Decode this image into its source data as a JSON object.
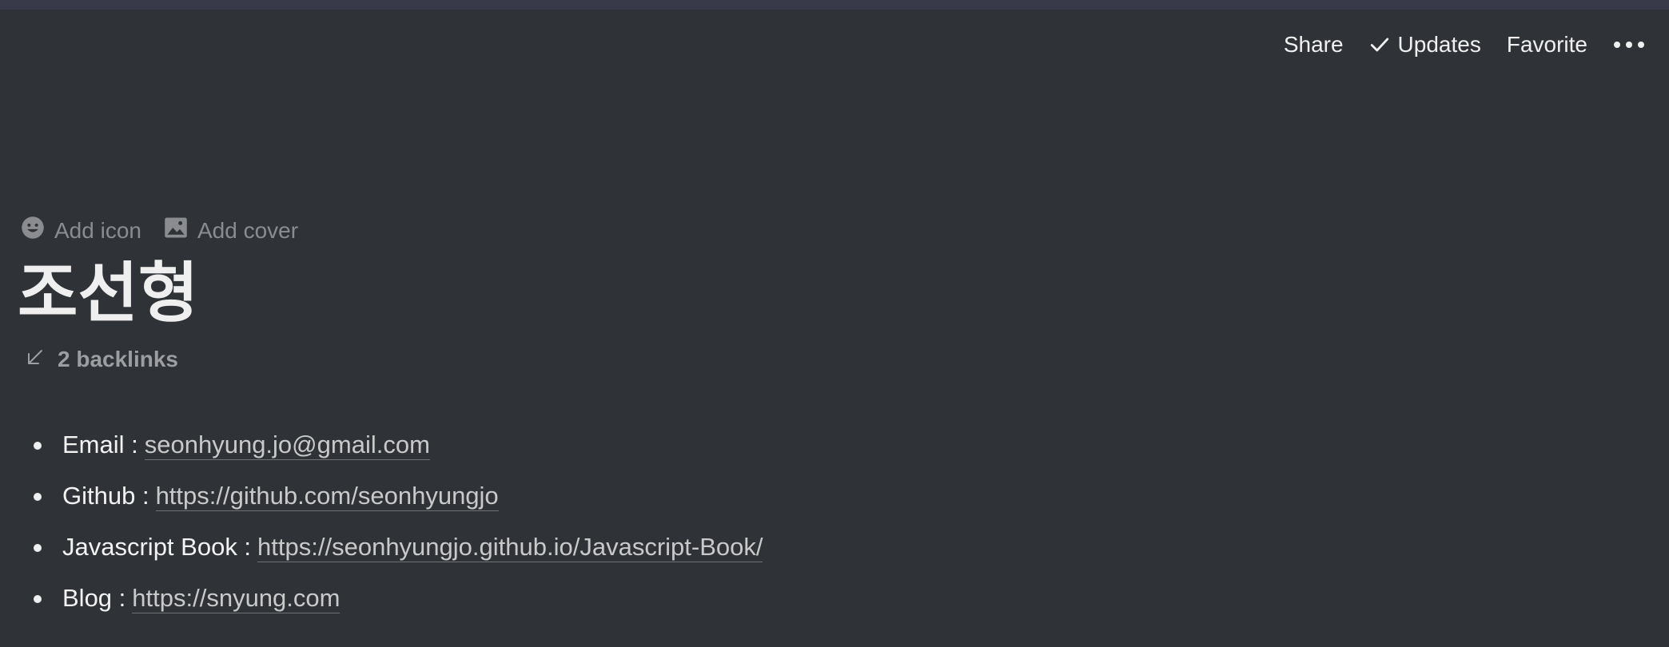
{
  "topbar": {
    "share_label": "Share",
    "updates_label": "Updates",
    "favorite_label": "Favorite",
    "more_icon": "more-horizontal-icon"
  },
  "page_actions": {
    "add_icon_label": "Add icon",
    "add_cover_label": "Add cover"
  },
  "page": {
    "title": "조선형",
    "backlinks_label": "2 backlinks"
  },
  "links": [
    {
      "label": "Email :",
      "url": "seonhyung.jo@gmail.com"
    },
    {
      "label": "Github :",
      "url": "https://github.com/seonhyungjo"
    },
    {
      "label": "Javascript Book :",
      "url": "https://seonhyungjo.github.io/Javascript-Book/"
    },
    {
      "label": "Blog :",
      "url": "https://snyung.com"
    }
  ],
  "colors": {
    "background": "#2f3337",
    "top_strip": "#383a4a",
    "text": "#f0f0f0",
    "muted": "#8b8c8f"
  }
}
